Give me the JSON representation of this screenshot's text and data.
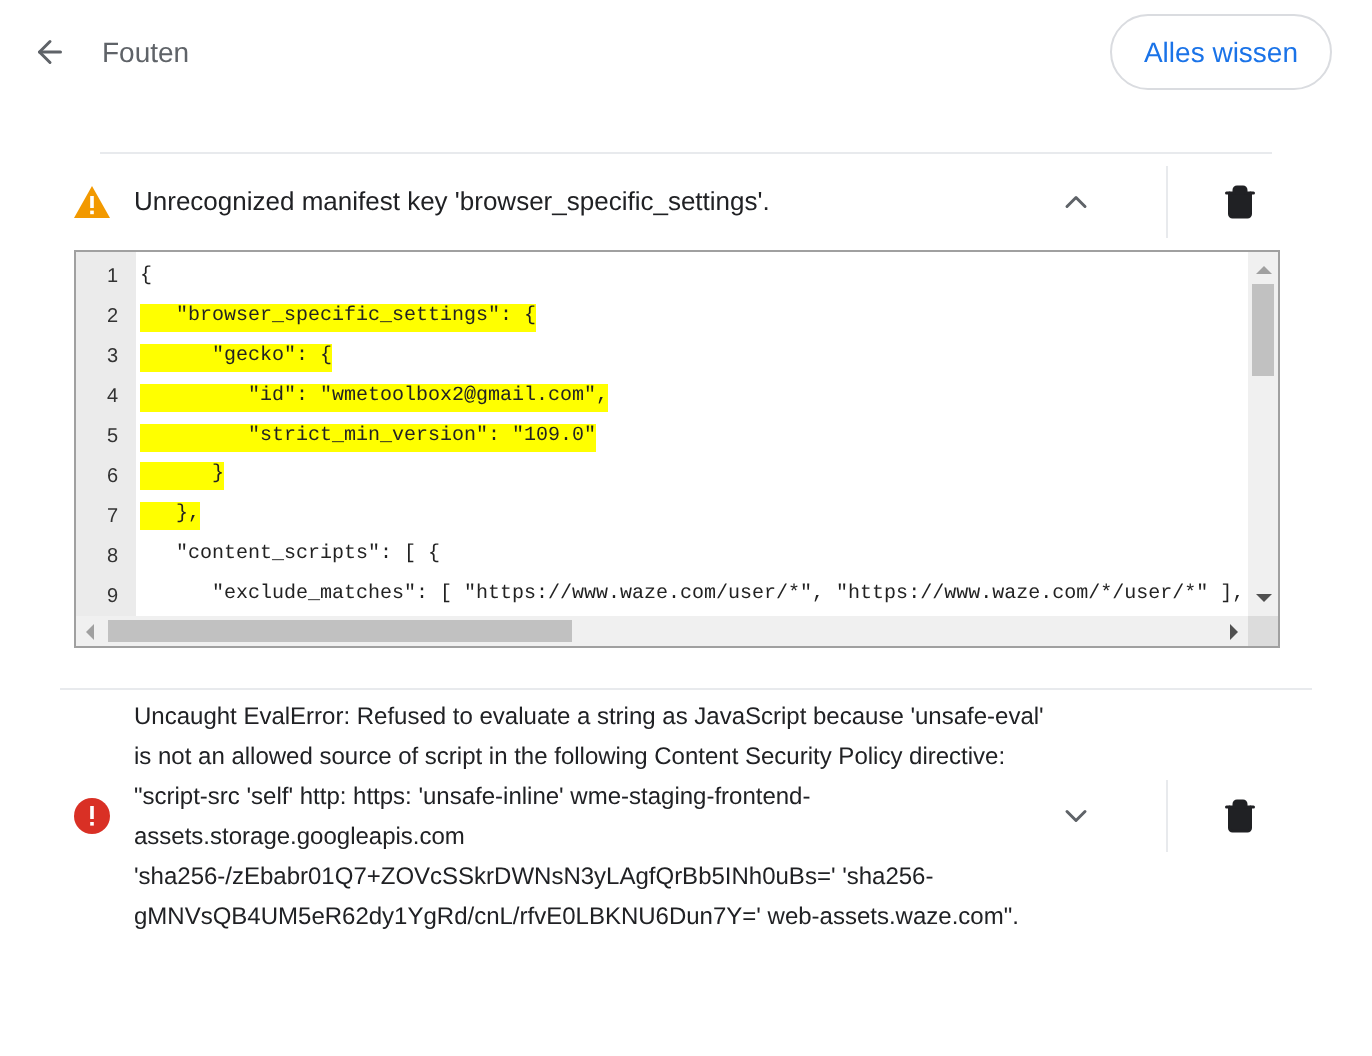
{
  "header": {
    "title": "Fouten",
    "clear_button": "Alles wissen"
  },
  "errors": [
    {
      "kind": "warning",
      "message": "Unrecognized manifest key 'browser_specific_settings'.",
      "expanded": true,
      "code": [
        {
          "number": "1",
          "text": "{",
          "highlighted": false
        },
        {
          "number": "2",
          "text": "   \"browser_specific_settings\": {",
          "highlighted": true
        },
        {
          "number": "3",
          "text": "      \"gecko\": {",
          "highlighted": true
        },
        {
          "number": "4",
          "text": "         \"id\": \"wmetoolbox2@gmail.com\",",
          "highlighted": true
        },
        {
          "number": "5",
          "text": "         \"strict_min_version\": \"109.0\"",
          "highlighted": true
        },
        {
          "number": "6",
          "text": "      }",
          "highlighted": true
        },
        {
          "number": "7",
          "text": "   },",
          "highlighted": true
        },
        {
          "number": "8",
          "text": "   \"content_scripts\": [ {",
          "highlighted": false
        },
        {
          "number": "9",
          "text": "      \"exclude_matches\": [ \"https://www.waze.com/user/*\", \"https://www.waze.com/*/user/*\" ],",
          "highlighted": false
        }
      ]
    },
    {
      "kind": "error",
      "message": "Uncaught EvalError: Refused to evaluate a string as JavaScript because 'unsafe-eval' is not an allowed source of script in the following Content Security Policy directive: \"script-src 'self' http: https: 'unsafe-inline' wme-staging-frontend-assets.storage.googleapis.com 'sha256-/zEbabr01Q7+ZOVcSSkrDWNsN3yLAgfQrBb5INh0uBs=' 'sha256-gMNVsQB4UM5eR62dy1YgRd/cnL/rfvE0LBKNU6Dun7Y=' web-assets.waze.com\".",
      "expanded": false
    }
  ]
}
